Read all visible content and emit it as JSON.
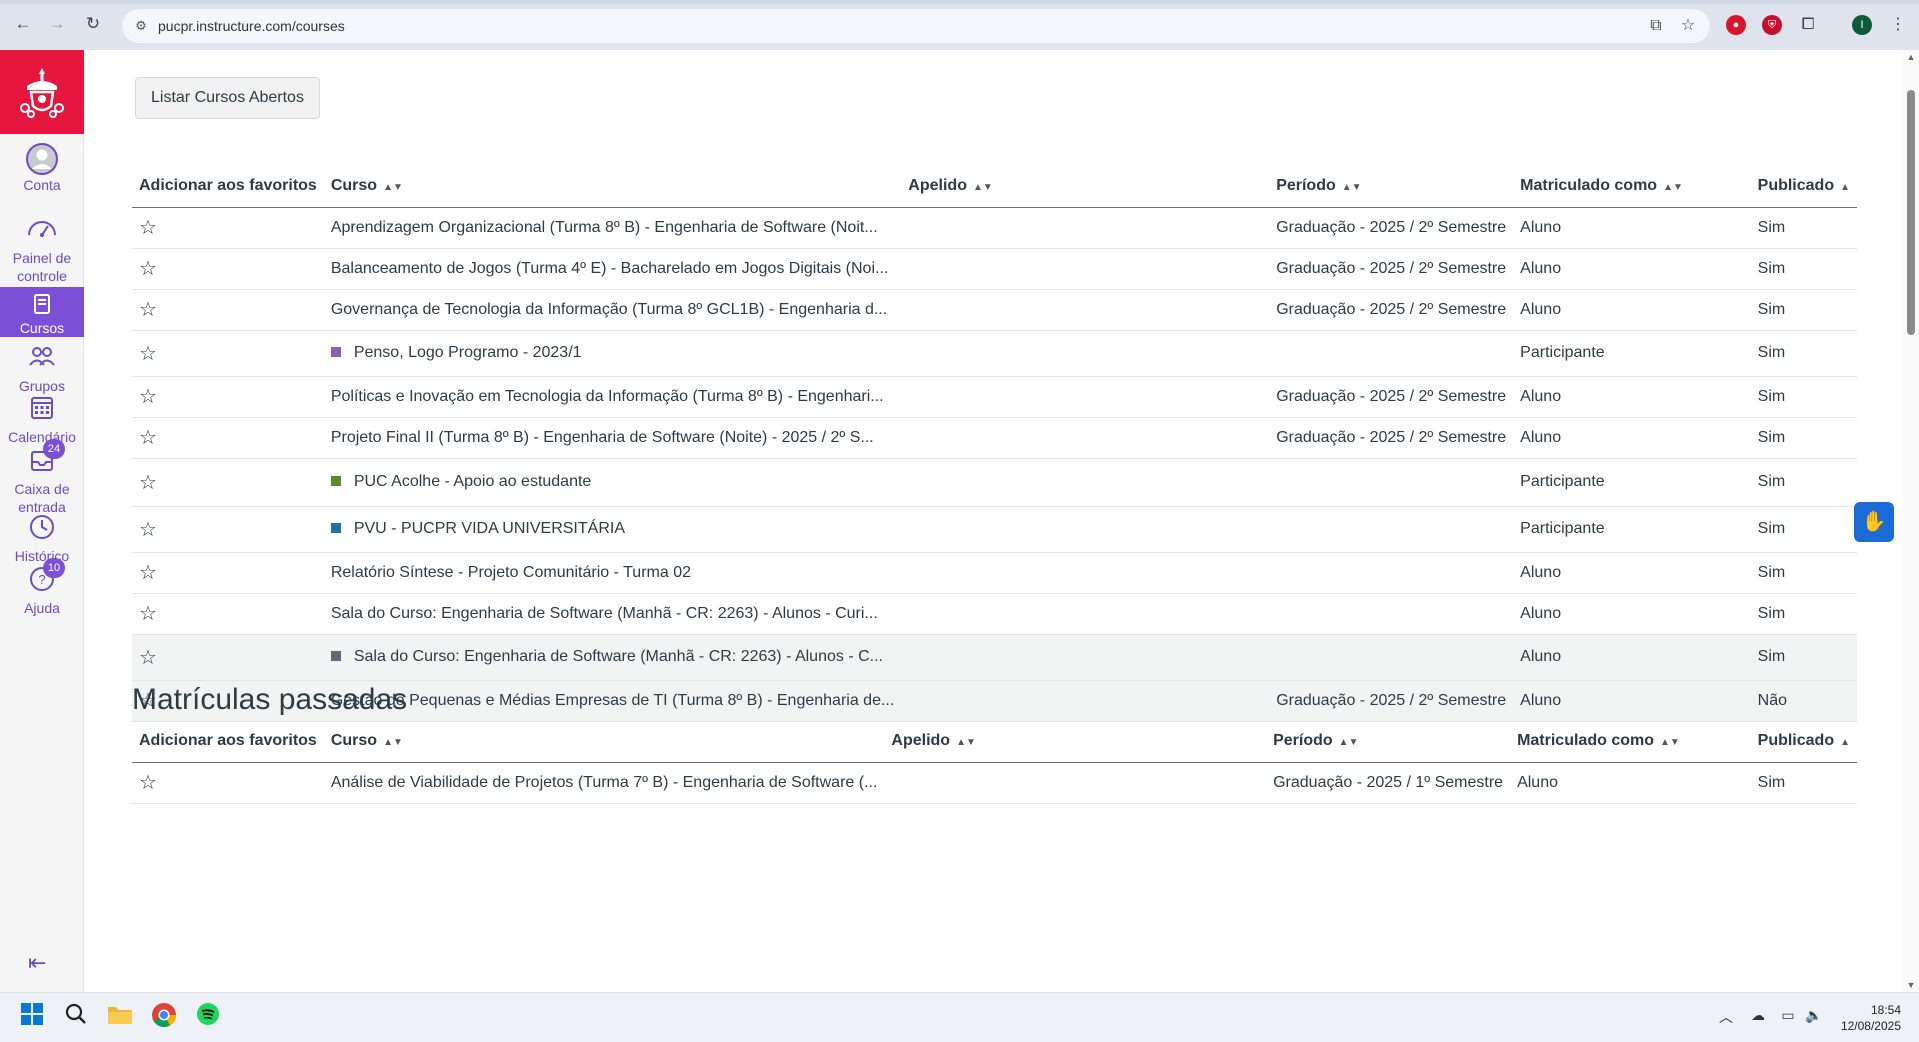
{
  "browser": {
    "url": "pucpr.instructure.com/courses",
    "profile_initial": "I"
  },
  "nav": {
    "items": [
      {
        "label": "Conta"
      },
      {
        "label": "Painel de controle"
      },
      {
        "label": "Cursos"
      },
      {
        "label": "Grupos"
      },
      {
        "label": "Calendário"
      },
      {
        "label": "Caixa de entrada",
        "badge": "24"
      },
      {
        "label": "Histórico"
      },
      {
        "label": "Ajuda",
        "badge": "10"
      }
    ]
  },
  "main": {
    "open_courses_button": "Listar Cursos Abertos",
    "columns": {
      "favorite": "Adicionar aos favoritos",
      "course": "Curso",
      "nickname": "Apelido",
      "term": "Período",
      "enrolled_as": "Matriculado como",
      "published": "Publicado"
    },
    "current_courses": [
      {
        "course": "Aprendizagem Organizacional (Turma 8º B) - Engenharia de Software (Noit...",
        "term": "Graduação - 2025 / 2º Semestre",
        "role": "Aluno",
        "published": "Sim"
      },
      {
        "course": "Balanceamento de Jogos (Turma 4º E) - Bacharelado em Jogos Digitais (Noi...",
        "term": "Graduação - 2025 / 2º Semestre",
        "role": "Aluno",
        "published": "Sim"
      },
      {
        "course": "Governança de Tecnologia da Informação (Turma 8º GCL1B) - Engenharia d...",
        "term": "Graduação - 2025 / 2º Semestre",
        "role": "Aluno",
        "published": "Sim"
      },
      {
        "course": "Penso, Logo Programo - 2023/1",
        "color": "#8e5fb0",
        "term": "",
        "role": "Participante",
        "published": "Sim"
      },
      {
        "course": "Políticas e Inovação em Tecnologia da Informação (Turma 8º B) - Engenhari...",
        "term": "Graduação - 2025 / 2º Semestre",
        "role": "Aluno",
        "published": "Sim"
      },
      {
        "course": "Projeto Final II (Turma 8º B) - Engenharia de Software (Noite) - 2025 / 2º S...",
        "term": "Graduação - 2025 / 2º Semestre",
        "role": "Aluno",
        "published": "Sim"
      },
      {
        "course": "PUC Acolhe - Apoio ao estudante",
        "color": "#5a8a2e",
        "term": "",
        "role": "Participante",
        "published": "Sim"
      },
      {
        "course": "PVU - PUCPR VIDA UNIVERSITÁRIA",
        "color": "#1f6fa8",
        "term": "",
        "role": "Participante",
        "published": "Sim"
      },
      {
        "course": "Relatório Síntese - Projeto Comunitário - Turma 02",
        "term": "",
        "role": "Aluno",
        "published": "Sim"
      },
      {
        "course": "Sala do Curso: Engenharia de Software (Manhã - CR: 2263) - Alunos - Curi...",
        "term": "",
        "role": "Aluno",
        "published": "Sim"
      },
      {
        "course": "Sala do Curso: Engenharia de Software (Manhã - CR: 2263) - Alunos - C...",
        "color": "#5d6b78",
        "term": "",
        "role": "Aluno",
        "published": "Sim"
      },
      {
        "course": "Gestão de Pequenas e Médias Empresas de TI (Turma 8º B) - Engenharia de...",
        "term": "Graduação - 2025 / 2º Semestre",
        "role": "Aluno",
        "published": "Não"
      }
    ],
    "past_title": "Matrículas passadas",
    "past_courses": [
      {
        "course": "Análise de Viabilidade de Projetos (Turma 7º B) - Engenharia de Software (...",
        "term": "Graduação - 2025 / 1º Semestre",
        "role": "Aluno",
        "published": "Sim"
      }
    ]
  },
  "taskbar": {
    "time": "18:54",
    "date": "12/08/2025"
  },
  "colors": {
    "brand_red": "#e5173f",
    "nav_purple": "#7b4fd6",
    "unpublished": "#e66a1e"
  }
}
